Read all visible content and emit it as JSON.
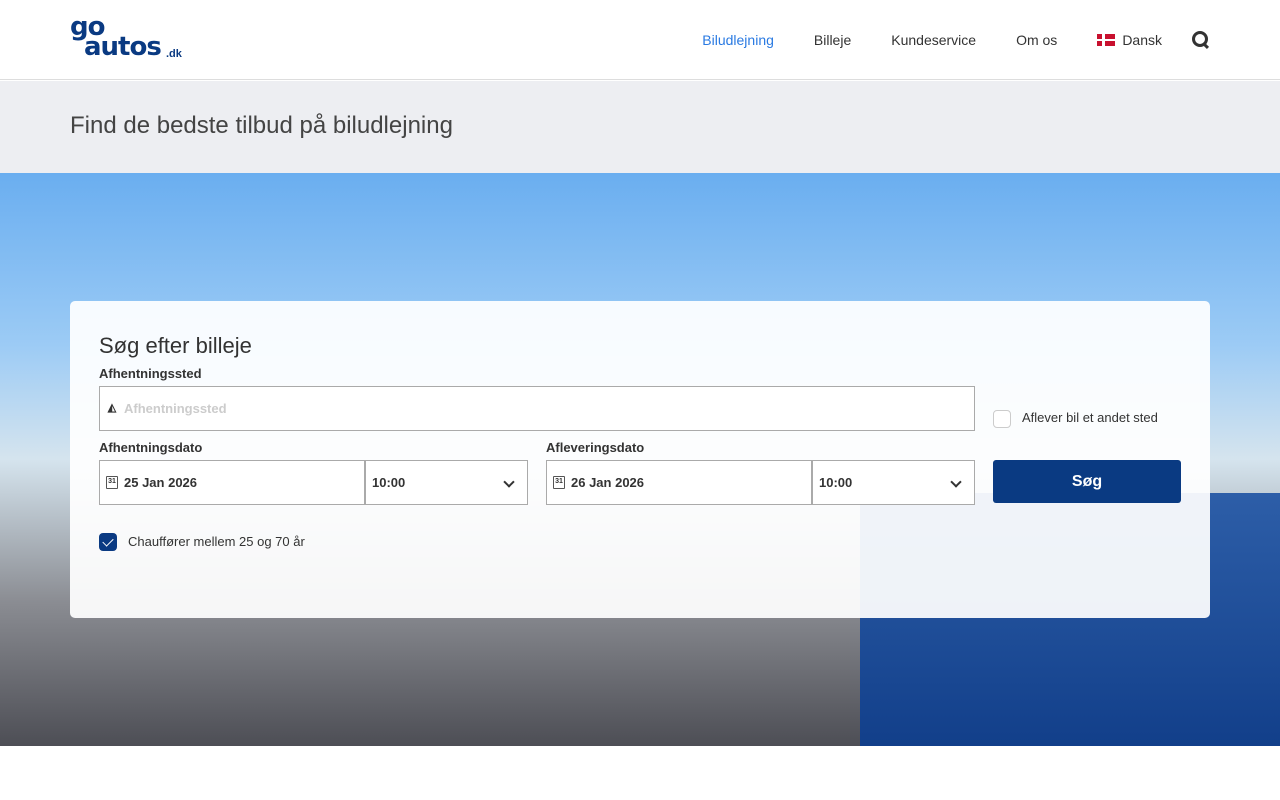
{
  "header": {
    "logo_text": "go autos .dk",
    "nav": [
      {
        "label": "Biludlejning",
        "active": true
      },
      {
        "label": "Billeje"
      },
      {
        "label": "Kundeservice"
      },
      {
        "label": "Om os"
      }
    ],
    "language": "Dansk"
  },
  "banner": {
    "title": "Find de bedste tilbud på biludlejning"
  },
  "search": {
    "title": "Søg efter billeje",
    "pickup_label": "Afhentningssted",
    "pickup_placeholder": "Afhentningssted",
    "pickup_value": "",
    "return_other_label": "Aflever bil et andet sted",
    "return_other_checked": false,
    "pickup_date_label": "Afhentningsdato",
    "pickup_date": "25 Jan 2026",
    "pickup_time": "10:00",
    "return_date_label": "Afleveringsdato",
    "return_date": "26 Jan 2026",
    "return_time": "10:00",
    "calendar_day": "31",
    "driver_age_label": "Chauffører mellem 25 og 70 år",
    "driver_age_checked": true,
    "submit": "Søg"
  }
}
